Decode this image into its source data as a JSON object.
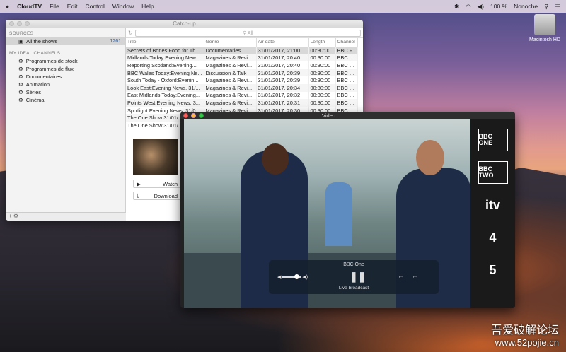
{
  "menubar": {
    "apple": "",
    "app": "CloudTV",
    "items": [
      "File",
      "Edit",
      "Control",
      "Window",
      "Help"
    ],
    "battery": "100 %",
    "user": "Nonoche"
  },
  "desktop": {
    "disk_label": "Macintosh HD"
  },
  "catchup": {
    "title": "Catch-up",
    "sources_header": "SOURCES",
    "all_shows": "All the shows",
    "all_count": "1261",
    "channels_header": "MY IDEAL CHANNELS",
    "channels": [
      "Programmes de stock",
      "Programmes de flux",
      "Documentaires",
      "Animation",
      "Séries",
      "Cinéma"
    ],
    "search_placeholder": "All",
    "columns": [
      "Title",
      "Genre",
      "Air date",
      "Length",
      "Channel"
    ],
    "rows": [
      [
        "Secrets of Bones:Food for Th...",
        "Documentaries",
        "31/01/2017, 21:00",
        "00:30:00",
        "BBC F..."
      ],
      [
        "Midlands Today:Evening New...",
        "Magazines & Revi...",
        "31/01/2017, 20:40",
        "00:30:00",
        "BBC O..."
      ],
      [
        "Reporting Scotland:Evening...",
        "Magazines & Revi...",
        "31/01/2017, 20:40",
        "00:30:00",
        "BBC O..."
      ],
      [
        "BBC Wales Today:Evening Ne...",
        "Discussion & Talk",
        "31/01/2017, 20:39",
        "00:30:00",
        "BBC O..."
      ],
      [
        "South Today - Oxford:Evenin...",
        "Magazines & Revi...",
        "31/01/2017, 20:39",
        "00:30:00",
        "BBC O..."
      ],
      [
        "Look East:Evening News, 31/...",
        "Magazines & Revi...",
        "31/01/2017, 20:34",
        "00:30:00",
        "BBC O..."
      ],
      [
        "East Midlands Today:Evening...",
        "Magazines & Revi...",
        "31/01/2017, 20:32",
        "00:30:00",
        "BBC O..."
      ],
      [
        "Points West:Evening News, 3...",
        "Magazines & Revi...",
        "31/01/2017, 20:31",
        "00:30:00",
        "BBC O..."
      ],
      [
        "Spotlight:Evening News, 31/0...",
        "Magazines & Revi...",
        "31/01/2017, 20:30",
        "00:30:00",
        "BBC O..."
      ],
      [
        "The One Show:31/01/...",
        "",
        "",
        "",
        ""
      ],
      [
        "The One Show:31/01/...",
        "",
        "",
        "",
        ""
      ]
    ],
    "watch": "Watch",
    "download": "Download"
  },
  "video": {
    "title": "Video",
    "channel": "BBC One",
    "status": "Live broadcast",
    "volume": 0.75,
    "channels": [
      "BBC ONE",
      "BBC TWO",
      "itv",
      "4",
      "5"
    ]
  },
  "watermark": {
    "line1": "吾爱破解论坛",
    "line2": "www.52pojie.cn"
  }
}
